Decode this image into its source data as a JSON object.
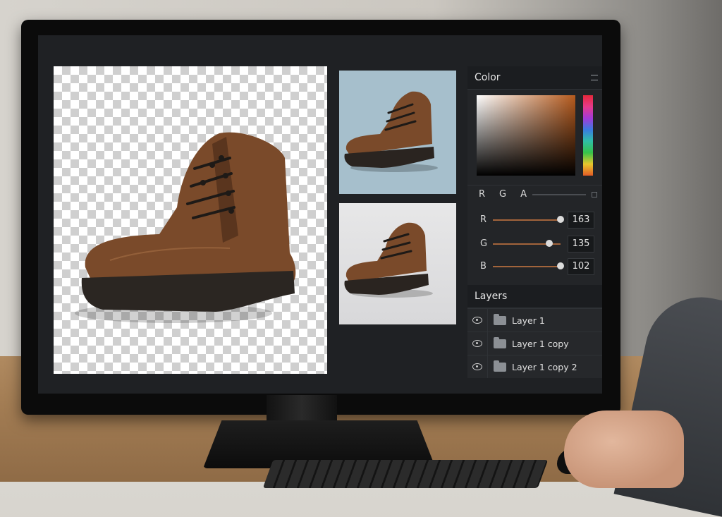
{
  "color_panel": {
    "title": "Color",
    "mode_labels": [
      "R",
      "G",
      "A"
    ],
    "sliders": [
      {
        "label": "R",
        "value": "163",
        "level": 1.0
      },
      {
        "label": "G",
        "value": "135",
        "level": 0.83
      },
      {
        "label": "B",
        "value": "102",
        "level": 1.0
      }
    ]
  },
  "layers_panel": {
    "title": "Layers",
    "layers": [
      {
        "name": "Layer 1"
      },
      {
        "name": "Layer 1 copy"
      },
      {
        "name": "Layer 1 copy 2"
      }
    ]
  },
  "colors": {
    "boot_brown": "#7a4a2a",
    "thumb_bg_blue": "#a6bfcc",
    "thumb_bg_gray": "#e0e0e2",
    "panel_bg": "#232528"
  },
  "icons": [
    "eye-icon",
    "folder-icon",
    "menu-icon"
  ]
}
